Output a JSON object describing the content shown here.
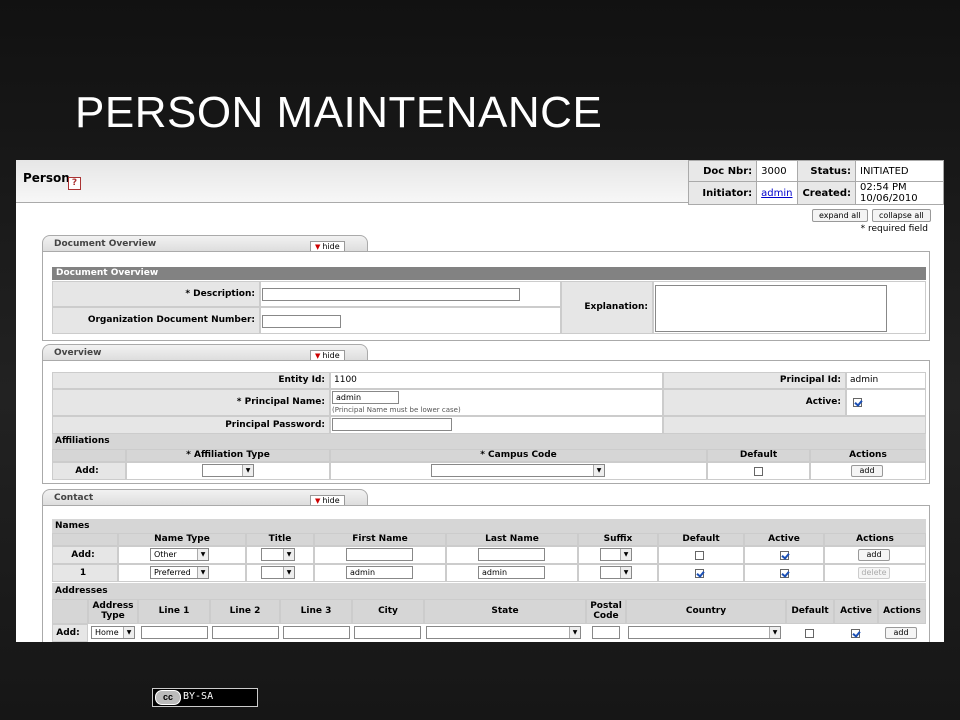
{
  "slide": {
    "title": "PERSON MAINTENANCE",
    "license": "BY-SA",
    "license_logo": "cc"
  },
  "header": {
    "page_title": "Person",
    "help_icon": "?",
    "doc_nbr_label": "Doc Nbr:",
    "doc_nbr": "3000",
    "status_label": "Status:",
    "status": "INITIATED",
    "initiator_label": "Initiator:",
    "initiator": "admin",
    "created_label": "Created:",
    "created": "02:54 PM 10/06/2010"
  },
  "toolbar": {
    "expand_all": "expand all",
    "collapse_all": "collapse all",
    "required_note": "* required field"
  },
  "hide_label": "hide",
  "document_overview": {
    "tab": "Document Overview",
    "section_title": "Document Overview",
    "description_label": "* Description:",
    "description_value": "",
    "org_doc_number_label": "Organization Document Number:",
    "org_doc_number_value": "",
    "explanation_label": "Explanation:",
    "explanation_value": ""
  },
  "overview": {
    "tab": "Overview",
    "entity_id_label": "Entity Id:",
    "entity_id": "1100",
    "principal_id_label": "Principal Id:",
    "principal_id": "admin",
    "principal_name_label": "* Principal Name:",
    "principal_name": "admin",
    "principal_name_hint": "(Principal Name must be lower case)",
    "active_label": "Active:",
    "active": true,
    "principal_password_label": "Principal Password:",
    "principal_password": ""
  },
  "affiliations": {
    "title": "Affiliations",
    "headers": [
      "* Affiliation Type",
      "* Campus Code",
      "Default",
      "Actions"
    ],
    "add_label": "Add:",
    "add_button": "add"
  },
  "contact": {
    "tab": "Contact",
    "names": {
      "title": "Names",
      "headers": [
        "Name Type",
        "Title",
        "First Name",
        "Last Name",
        "Suffix",
        "Default",
        "Active",
        "Actions"
      ],
      "rows": [
        {
          "label": "Add:",
          "name_type": "Other",
          "title": "",
          "first": "",
          "last": "",
          "suffix": "",
          "default": false,
          "active": true,
          "action": "add"
        },
        {
          "label": "1",
          "name_type": "Preferred",
          "title": "",
          "first": "admin",
          "last": "admin",
          "suffix": "",
          "default": true,
          "active": true,
          "action": "delete"
        }
      ]
    },
    "addresses": {
      "title": "Addresses",
      "headers": [
        "Address Type",
        "Line 1",
        "Line 2",
        "Line 3",
        "City",
        "State",
        "Postal Code",
        "Country",
        "Default",
        "Active",
        "Actions"
      ],
      "add_label": "Add:",
      "address_type": "Home",
      "default": false,
      "active": true,
      "action": "add"
    }
  }
}
